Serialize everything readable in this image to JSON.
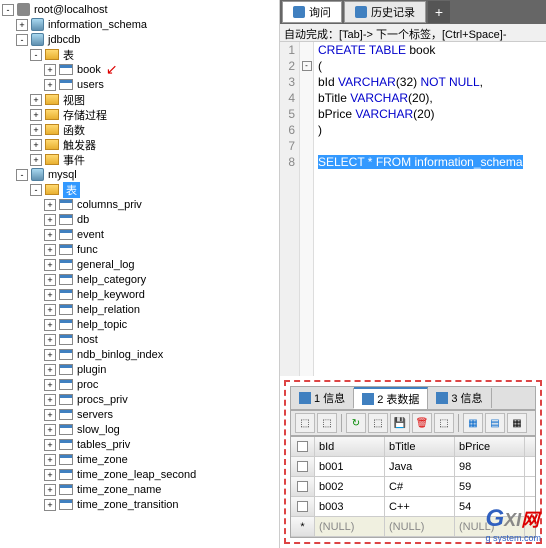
{
  "tree": {
    "root": "root@localhost",
    "dbs": [
      "information_schema",
      "jdbcdb",
      "mysql"
    ],
    "jdbcdb_tables_label": "表",
    "jdbcdb_tables": [
      "book",
      "users"
    ],
    "jdbcdb_folders": [
      "视图",
      "存储过程",
      "函数",
      "触发器",
      "事件"
    ],
    "mysql_tables_label": "表",
    "mysql_tables": [
      "columns_priv",
      "db",
      "event",
      "func",
      "general_log",
      "help_category",
      "help_keyword",
      "help_relation",
      "help_topic",
      "host",
      "ndb_binlog_index",
      "plugin",
      "proc",
      "procs_priv",
      "servers",
      "slow_log",
      "tables_priv",
      "time_zone",
      "time_zone_leap_second",
      "time_zone_name",
      "time_zone_transition"
    ]
  },
  "tabs": {
    "query": "询问",
    "history": "历史记录"
  },
  "hint": "自动完成：[Tab]-> 下一个标签，[Ctrl+Space]-",
  "code": {
    "l1a": "CREATE TABLE",
    "l1b": " book",
    "l2": "(",
    "l3a": "bId ",
    "l3b": "VARCHAR",
    "l3c": "(32) ",
    "l3d": "NOT NULL",
    "l3e": ",",
    "l4a": "bTitle ",
    "l4b": "VARCHAR",
    "l4c": "(20),",
    "l5a": "bPrice ",
    "l5b": "VARCHAR",
    "l5c": "(20)",
    "l6": ")",
    "l8a": "SELECT",
    "l8b": " * ",
    "l8c": "FROM",
    "l8d": " information_schema"
  },
  "data_tabs": {
    "t1": "1 信息",
    "t2": "2 表数据",
    "t3": "3 信息"
  },
  "grid": {
    "headers": [
      "bId",
      "bTitle",
      "bPrice"
    ],
    "rows": [
      [
        "b001",
        "Java",
        "98"
      ],
      [
        "b002",
        "C#",
        "59"
      ],
      [
        "b003",
        "C++",
        "54"
      ]
    ],
    "null": "(NULL)",
    "star": "*"
  },
  "logo": {
    "g": "G",
    "xi": "XI",
    "wang": "网",
    "sub": "g system.com"
  }
}
